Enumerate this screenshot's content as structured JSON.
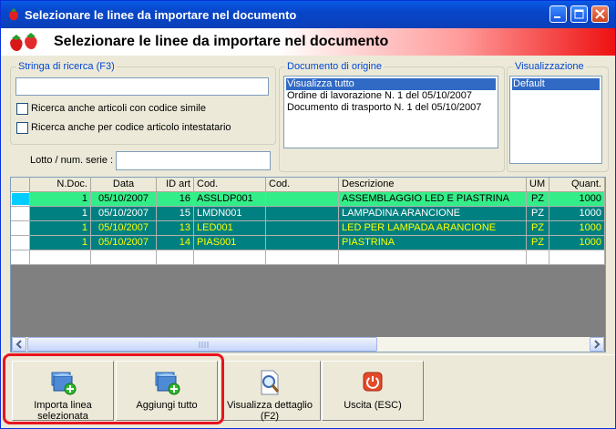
{
  "window": {
    "title": "Selezionare le linee da importare nel documento"
  },
  "header": {
    "title": "Selezionare le linee da importare nel documento"
  },
  "search": {
    "legend": "Stringa di ricerca (F3)",
    "value": "",
    "opt_similar": "Ricerca anche articoli con codice simile",
    "opt_holder": "Ricerca anche per codice articolo intestatario"
  },
  "lot": {
    "label": "Lotto / num. serie :",
    "value": ""
  },
  "origin": {
    "legend": "Documento di origine",
    "items": [
      "Visualizza tutto",
      "Ordine di lavorazione N. 1 del 05/10/2007",
      "Documento di trasporto N. 1 del 05/10/2007"
    ]
  },
  "view": {
    "legend": "Visualizzazione",
    "items": [
      "Default"
    ]
  },
  "grid": {
    "headers": [
      "N.Doc.",
      "Data",
      "ID art",
      "Cod.",
      "Cod.",
      "Descrizione",
      "UM",
      "Quant."
    ],
    "rows": [
      [
        "1",
        "05/10/2007",
        "16",
        "ASSLDP001",
        "",
        "ASSEMBLAGGIO LED E PIASTRINA",
        "PZ",
        "1000"
      ],
      [
        "1",
        "05/10/2007",
        "15",
        "LMDN001",
        "",
        "LAMPADINA ARANCIONE",
        "PZ",
        "1000"
      ],
      [
        "1",
        "05/10/2007",
        "13",
        "LED001",
        "",
        "LED PER LAMPADA ARANCIONE",
        "PZ",
        "1000"
      ],
      [
        "1",
        "05/10/2007",
        "14",
        "PIAS001",
        "",
        "PIASTRINA",
        "PZ",
        "1000"
      ]
    ]
  },
  "buttons": {
    "import_selected": "Importa linea selezionata",
    "add_all": "Aggiungi tutto",
    "view_detail": "Visualizza dettaglio (F2)",
    "exit": "Uscita (ESC)"
  },
  "colors": {
    "row_selected": "#33ee88",
    "row_teal": "#008080",
    "text_yellow": "#ffff00",
    "accent_red": "#e8141e"
  }
}
